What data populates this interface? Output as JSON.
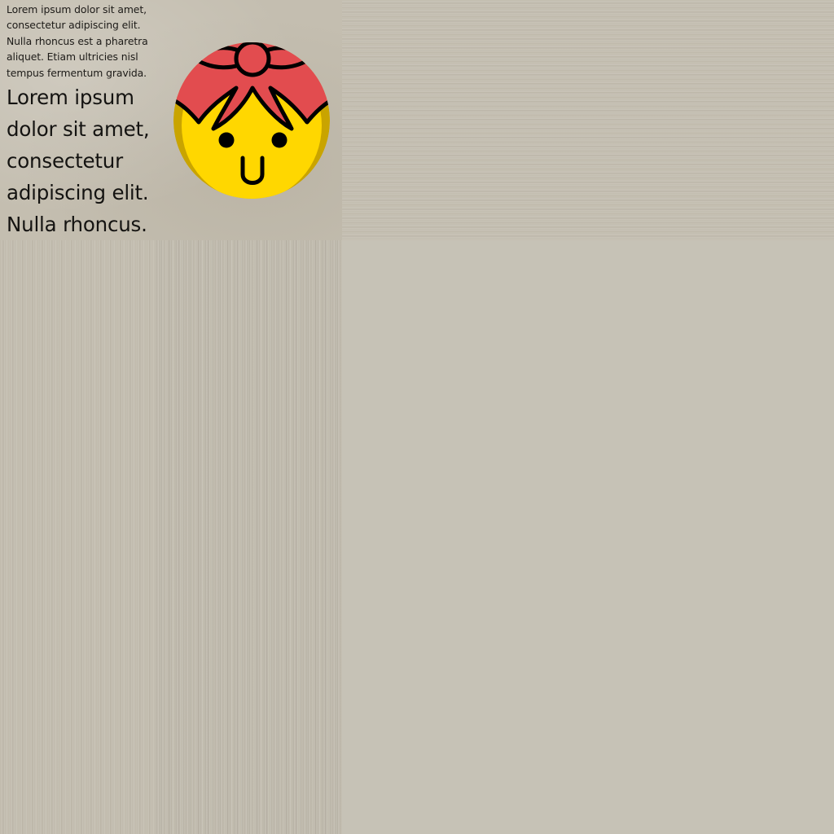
{
  "paragraph_small": "Lorem ipsum dolor sit amet, consectetur adipiscing elit. Nulla rhoncus est a pharetra aliquet. Etiam ultricies nisl tempus fermentum gravida.",
  "paragraph_large": "Lorem ipsum dolor sit amet, consectetur adipiscing elit. Nulla rhoncus.",
  "illustration": {
    "icon": "girl-face-with-bow-icon",
    "colors": {
      "face": "#ffd700",
      "face_shadow": "#c9a400",
      "bow": "#e24c4f",
      "outline": "#000000"
    }
  }
}
